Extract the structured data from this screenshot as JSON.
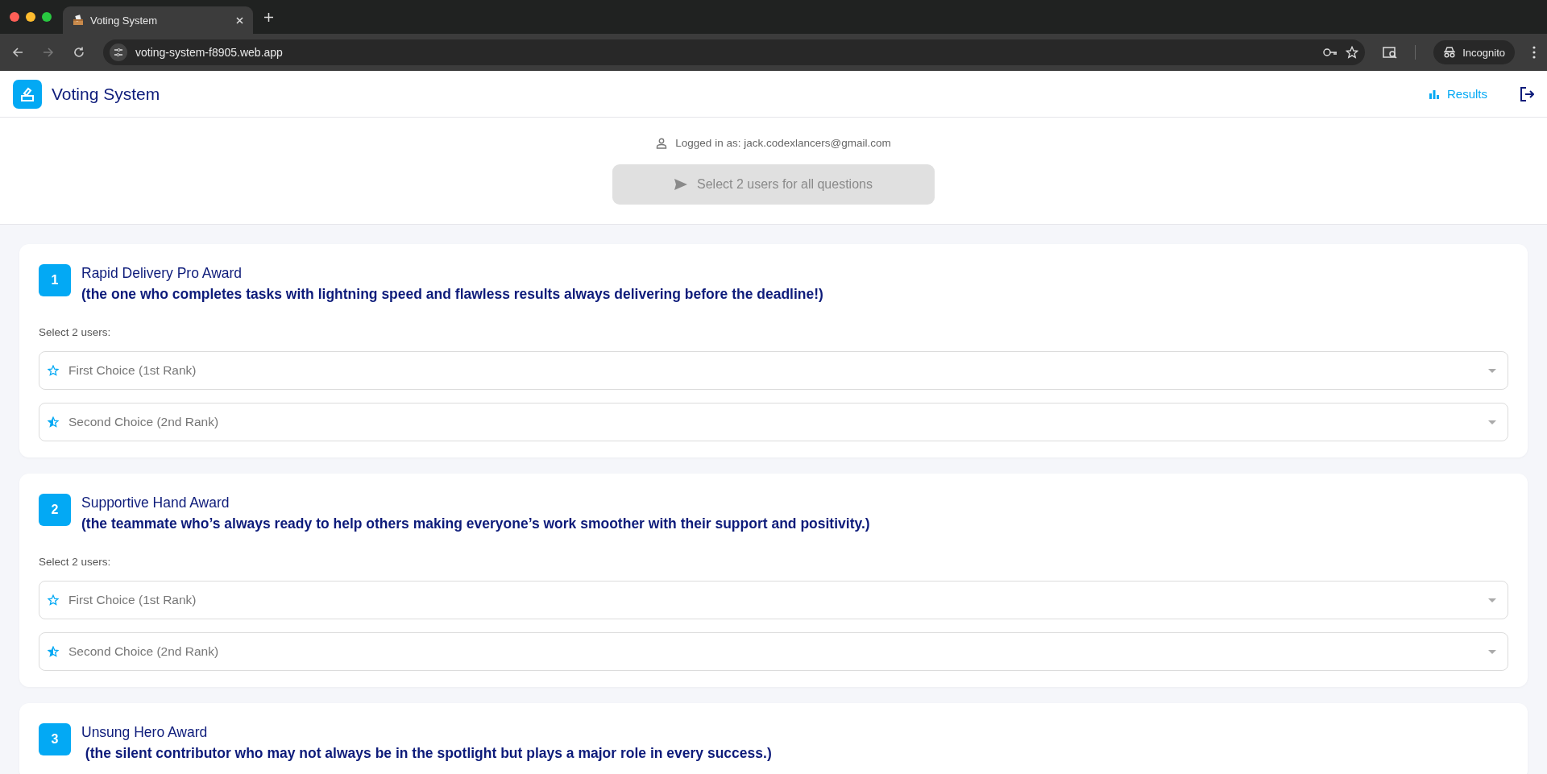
{
  "browser": {
    "tab_title": "Voting System",
    "url": "voting-system-f8905.web.app",
    "profile": "Incognito"
  },
  "app": {
    "title": "Voting System",
    "results_link": "Results"
  },
  "login": {
    "text": "Logged in as: jack.codexlancers@gmail.com"
  },
  "submit_button": {
    "label": "Select 2 users for all questions",
    "disabled": true
  },
  "questions": [
    {
      "number": "1",
      "title": "Rapid Delivery Pro Award",
      "description": "(the one who completes tasks with lightning speed and flawless results always delivering before the deadline!)",
      "select_label": "Select 2 users:",
      "choices": [
        {
          "kind": "first",
          "placeholder": "First Choice (1st Rank)"
        },
        {
          "kind": "second",
          "placeholder": "Second Choice (2nd Rank)"
        }
      ]
    },
    {
      "number": "2",
      "title": "Supportive Hand Award",
      "description": "(the teammate who’s always ready to help others making everyone’s work smoother with their support and positivity.)",
      "select_label": "Select 2 users:",
      "choices": [
        {
          "kind": "first",
          "placeholder": "First Choice (1st Rank)"
        },
        {
          "kind": "second",
          "placeholder": "Second Choice (2nd Rank)"
        }
      ]
    },
    {
      "number": "3",
      "title": "Unsung Hero Award",
      "description": " (the silent contributor who may not always be in the spotlight but plays a major role in every success.)"
    }
  ]
}
